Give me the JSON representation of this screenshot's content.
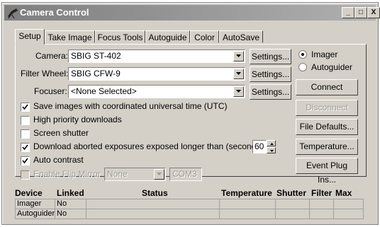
{
  "window": {
    "title": "Camera Control",
    "controls": {
      "minimize": "_",
      "maximize": "□",
      "close": "X"
    }
  },
  "tabs": [
    {
      "label": "Setup",
      "active": true
    },
    {
      "label": "Take Image"
    },
    {
      "label": "Focus Tools"
    },
    {
      "label": "Autoguide"
    },
    {
      "label": "Color"
    },
    {
      "label": "AutoSave"
    }
  ],
  "setup": {
    "camera": {
      "label": "Camera:",
      "value": "SBIG ST-402",
      "settings": "Settings..."
    },
    "filter_wheel": {
      "label": "Filter Wheel:",
      "value": "SBIG CFW-9",
      "settings": "Settings..."
    },
    "focuser": {
      "label": "Focuser:",
      "value": "<None Selected>",
      "settings": "Settings..."
    },
    "mode": {
      "imager": "Imager",
      "autoguider": "Autoguider",
      "selected": "Imager"
    },
    "connect": "Connect",
    "disconnect": "Disconnect",
    "file_defaults": "File Defaults...",
    "temperature": "Temperature...",
    "event_plugins": "Event Plug Ins...",
    "options": [
      {
        "label": "Save images with coordinated universal time (UTC)",
        "checked": true
      },
      {
        "label": "High priority downloads",
        "checked": false
      },
      {
        "label": "Screen shutter",
        "checked": false
      },
      {
        "label": "Download aborted exposures exposed longer than (seconds):",
        "checked": true
      },
      {
        "label": "Auto contrast",
        "checked": true
      },
      {
        "label": "Enable Flip Mirror",
        "checked": false,
        "disabled": true
      }
    ],
    "abort_seconds": "60",
    "flip_mirror_select": "None",
    "flip_mirror_port": "COM3"
  },
  "device_table": {
    "headers": [
      "Device",
      "Linked",
      "Status",
      "Temperature",
      "Shutter",
      "Filter",
      "Max"
    ],
    "rows": [
      {
        "device": "Imager",
        "linked": "No",
        "status": "",
        "temperature": "",
        "shutter": "",
        "filter": "",
        "max": ""
      },
      {
        "device": "Autoguider",
        "linked": "No",
        "status": "",
        "temperature": "",
        "shutter": "",
        "filter": "",
        "max": ""
      }
    ]
  }
}
